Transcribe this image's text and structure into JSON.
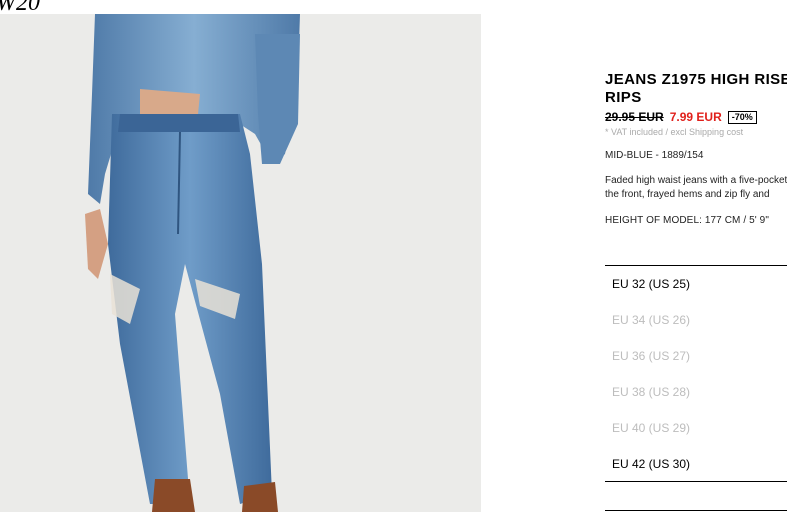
{
  "header": {
    "logo_fragment": "W20"
  },
  "product": {
    "title": "JEANS Z1975 HIGH RISE RIPS",
    "old_price": "29.95 EUR",
    "new_price": "7.99 EUR",
    "discount": "-70%",
    "vat_note": "* VAT included / excl Shipping cost",
    "color_ref": "MID-BLUE - 1889/154",
    "description_line1": "Faded high waist jeans with a five-pocket",
    "description_line2": "the front, frayed hems and zip fly and",
    "model_height": "HEIGHT OF MODEL: 177 CM / 5' 9\""
  },
  "sizes": [
    {
      "label": "EU 32 (US 25)",
      "available": true
    },
    {
      "label": "EU 34 (US 26)",
      "available": false
    },
    {
      "label": "EU 36 (US 27)",
      "available": false
    },
    {
      "label": "EU 38 (US 28)",
      "available": false
    },
    {
      "label": "EU 40 (US 29)",
      "available": false
    },
    {
      "label": "EU 42 (US 30)",
      "available": true
    }
  ],
  "colors": {
    "new_price": "#e0201b",
    "unavailable": "#bdbdbd",
    "image_bg": "#ebebe9",
    "denim": "#4a77a8"
  }
}
